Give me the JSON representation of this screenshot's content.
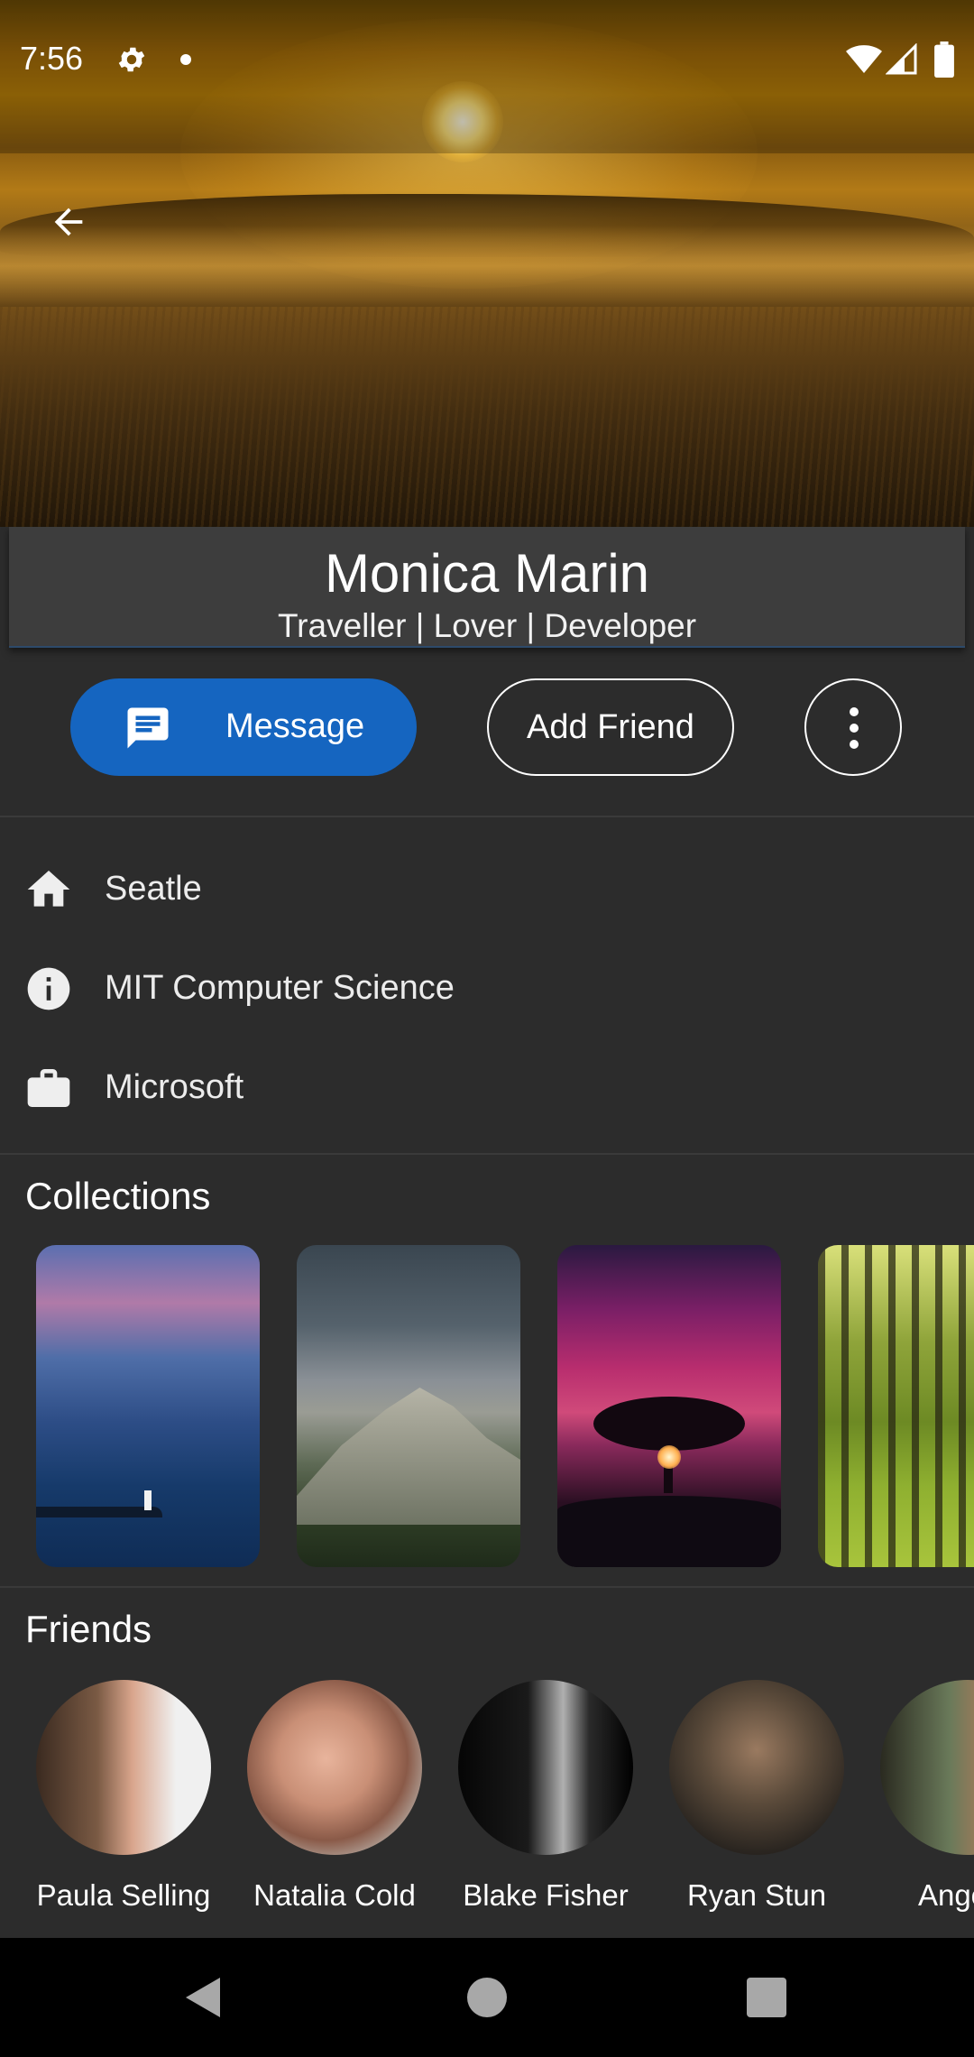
{
  "status_bar": {
    "time": "7:56"
  },
  "profile": {
    "name": "Monica Marin",
    "tagline": "Traveller | Lover | Developer"
  },
  "actions": {
    "message_label": "Message",
    "add_friend_label": "Add Friend"
  },
  "info": [
    {
      "icon": "home-icon",
      "text": "Seatle"
    },
    {
      "icon": "info-icon",
      "text": "MIT Computer Science"
    },
    {
      "icon": "briefcase-icon",
      "text": "Microsoft"
    }
  ],
  "collections": {
    "title": "Collections"
  },
  "friends": {
    "title": "Friends",
    "items": [
      {
        "name": "Paula Selling"
      },
      {
        "name": "Natalia Cold"
      },
      {
        "name": "Blake Fisher"
      },
      {
        "name": "Ryan Stun"
      },
      {
        "name": "Angelin"
      }
    ]
  },
  "colors": {
    "accent": "#1565c0",
    "background": "#2c2c2c",
    "card": "#3d3d3d",
    "navbar": "#000000"
  }
}
